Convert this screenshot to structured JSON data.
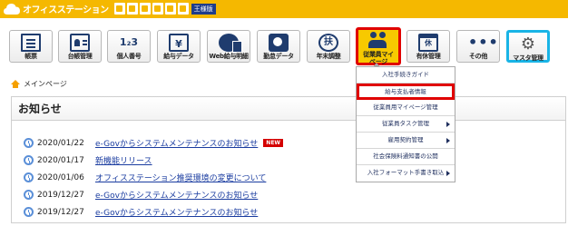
{
  "header": {
    "brand": "オフィスステーション",
    "edition": "王様版",
    "mini_icons": [
      "download-icon",
      "folder-icon",
      "mail-icon",
      "settings-icon",
      "lock-icon",
      "edit-icon"
    ]
  },
  "nav": {
    "items": [
      {
        "label": "帳票",
        "icon": "document-icon"
      },
      {
        "label": "台帳管理",
        "icon": "ledger-icon"
      },
      {
        "label": "個人番号",
        "icon": "mynumber-icon"
      },
      {
        "label": "給与データ",
        "icon": "salary-data-icon"
      },
      {
        "label": "Web給与明細",
        "icon": "web-payslip-icon"
      },
      {
        "label": "勤怠データ",
        "icon": "attendance-icon"
      },
      {
        "label": "年末調整",
        "icon": "yearend-icon"
      },
      {
        "label": "従業員マイページ",
        "icon": "employee-mypage-icon"
      },
      {
        "label": "有休管理",
        "icon": "paid-leave-icon"
      },
      {
        "label": "その他",
        "icon": "more-icon"
      },
      {
        "label": "マスタ管理",
        "icon": "master-settings-icon"
      }
    ],
    "icon_glyphs": {
      "yen": "¥",
      "fu": "扶",
      "kyu": "休",
      "dots": "•••",
      "gear": "⚙",
      "num": "1₂3"
    }
  },
  "dropdown": {
    "items": [
      {
        "label": "入社手続きガイド",
        "has_arrow": false
      },
      {
        "label": "給与支払者情報",
        "has_arrow": false,
        "highlighted": true
      },
      {
        "label": "従業員用マイページ管理",
        "has_arrow": false
      },
      {
        "label": "従業員タスク管理",
        "has_arrow": true
      },
      {
        "label": "雇用契約管理",
        "has_arrow": true
      },
      {
        "label": "社会保険料通知書の公開",
        "has_arrow": false
      },
      {
        "label": "入社フォーマット手書き取込",
        "has_arrow": true
      }
    ]
  },
  "breadcrumb": {
    "label": "メインページ"
  },
  "notices": {
    "title": "お知らせ",
    "items": [
      {
        "date": "2020/01/22",
        "text": "e-Govからシステムメンテナンスのお知らせ",
        "badge": "NEW"
      },
      {
        "date": "2020/01/17",
        "text": "新機能リリース",
        "badge": ""
      },
      {
        "date": "2020/01/06",
        "text": "オフィスステーション推奨環境の変更について",
        "badge": ""
      },
      {
        "date": "2019/12/27",
        "text": "e-Govからシステムメンテナンスのお知らせ",
        "badge": ""
      },
      {
        "date": "2019/12/27",
        "text": "e-Govからシステムメンテナンスのお知らせ",
        "badge": ""
      }
    ]
  },
  "colors": {
    "header_bg": "#f5b800",
    "highlight_red": "#e00000",
    "highlight_blue": "#19b4e6",
    "icon_navy": "#1f3c6e",
    "link": "#1a3ca0"
  }
}
